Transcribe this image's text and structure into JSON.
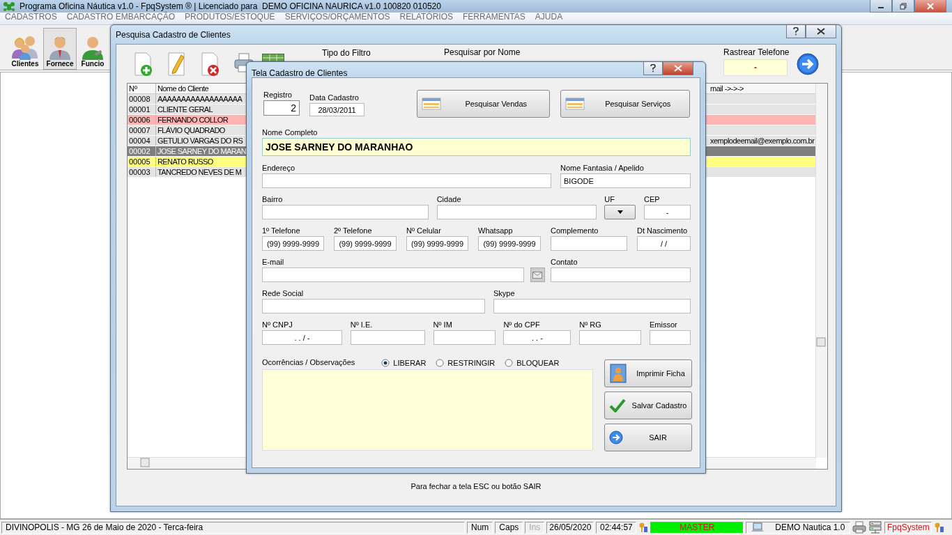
{
  "window": {
    "title": "Programa Oficina Náutica v1.0 - FpqSystem ® | Licenciado para  DEMO OFICINA NAURICA v1.0 100820 010520"
  },
  "menu": [
    "CADASTROS",
    "CADASTRO EMBARCAÇÃO",
    "PRODUTOS/ESTOQUE",
    "SERVIÇOS/ORÇAMENTOS",
    "RELATÓRIOS",
    "FERRAMENTAS",
    "AJUDA"
  ],
  "toolbar": [
    {
      "label": "Clientes",
      "selected": false
    },
    {
      "label": "Fornece",
      "selected": true
    },
    {
      "label": "Funcio",
      "selected": false
    }
  ],
  "search_window": {
    "title": "Pesquisa Cadastro de Clientes",
    "filter_label": "Tipo do Filtro",
    "name_label": "Pesquisar por Nome",
    "phone_label": "Rastrear Telefone",
    "phone_value": "-",
    "columns": [
      "Nº",
      "Nome do Cliente",
      "mail ->->->"
    ],
    "rows": [
      {
        "number": "00008",
        "name": "AAAAAAAAAAAAAAAAAA",
        "selected": false,
        "color": "#e4e4e4"
      },
      {
        "number": "00001",
        "name": "CLIENTE GERAL",
        "selected": false,
        "color": "#e4e4e4"
      },
      {
        "number": "00006",
        "name": "FERNANDO COLLOR",
        "selected": false,
        "color": "#ffb3b3"
      },
      {
        "number": "00007",
        "name": "FLÁVIO QUADRADO",
        "selected": false,
        "color": "#e4e4e4"
      },
      {
        "number": "00004",
        "name": "GETULIO VARGAS DO RS",
        "email": "xemplodeemail@exemplo.com.br",
        "selected": false,
        "color": "#e4e4e4"
      },
      {
        "number": "00002",
        "name": "JOSE SARNEY DO MARAN",
        "selected": true
      },
      {
        "number": "00005",
        "name": "RENATO RUSSO",
        "selected": false,
        "color": "#ffff80"
      },
      {
        "number": "00003",
        "name": "TANCREDO NEVES DE M",
        "selected": false,
        "color": "#e4e4e4"
      }
    ],
    "footer": "Para fechar a tela ESC ou botão SAIR"
  },
  "record_window": {
    "title": "Tela Cadastro de Clientes",
    "registro_label": "Registro",
    "registro": "2",
    "date_label": "Data Cadastro",
    "date": "28/03/2011",
    "top_buttons": [
      "Pesquisar Vendas",
      "Pesquisar Serviços"
    ],
    "name_label": "Nome Completo",
    "name": "JOSE SARNEY DO MARANHAO",
    "form_rows": [
      [
        {
          "kind": "text",
          "label": "Endereço"
        },
        {
          "kind": "text",
          "label": "Nome Fantasia / Apelido",
          "value": "BIGODE"
        }
      ],
      [
        {
          "kind": "text",
          "label": "Bairro"
        },
        {
          "kind": "text",
          "label": "Cidade"
        },
        {
          "kind": "dropdown",
          "label": "UF"
        },
        {
          "kind": "text",
          "label": "CEP",
          "value": "-"
        }
      ],
      [
        {
          "kind": "text",
          "label": "1º Telefone",
          "value": "(99) 9999-9999"
        },
        {
          "kind": "text",
          "label": "2º Telefone",
          "value": "(99) 9999-9999"
        },
        {
          "kind": "text",
          "label": "Nº Celular",
          "value": "(99) 9999-9999"
        },
        {
          "kind": "text",
          "label": "Whatsapp",
          "value": "(99) 9999-9999"
        },
        {
          "kind": "text",
          "label": "Complemento"
        },
        {
          "kind": "text",
          "label": "Dt Nascimento",
          "value": "/ /"
        }
      ],
      [
        {
          "kind": "text",
          "label": "E-mail"
        },
        {
          "kind": "button"
        },
        {
          "kind": "text",
          "label": "Contato"
        }
      ],
      [
        {
          "kind": "text",
          "label": "Rede Social"
        },
        {
          "kind": "text",
          "label": "Skype"
        }
      ],
      [
        {
          "kind": "text",
          "label": "Nº CNPJ",
          "value": ". . / -"
        },
        {
          "kind": "text",
          "label": "Nº I.E."
        },
        {
          "kind": "text",
          "label": "Nº IM"
        },
        {
          "kind": "text",
          "label": "Nº do CPF",
          "value": ". . -"
        },
        {
          "kind": "text",
          "label": "Nº RG"
        },
        {
          "kind": "text",
          "label": "Emissor"
        }
      ]
    ],
    "notes_label": "Ocorrências / Observações",
    "status_options": [
      {
        "label": "LIBERAR",
        "selected": true
      },
      {
        "label": "RESTRINGIR",
        "selected": false
      },
      {
        "label": "BLOQUEAR",
        "selected": false
      }
    ],
    "action_buttons": [
      {
        "kind": "print",
        "label": "Imprimir Ficha"
      },
      {
        "kind": "save",
        "label": "Salvar Cadastro"
      },
      {
        "kind": "exit",
        "label": "SAIR"
      }
    ]
  },
  "status_bar": [
    {
      "kind": "text",
      "text": "DIVINOPOLIS - MG 26 de Maio de 2020 - Terca-feira"
    },
    {
      "kind": "key",
      "text": "Num",
      "disabled": false
    },
    {
      "kind": "key",
      "text": "Caps",
      "disabled": false
    },
    {
      "kind": "key",
      "text": "Ins",
      "disabled": true
    },
    {
      "kind": "text",
      "text": "26/05/2020"
    },
    {
      "kind": "text",
      "text": "02:44:57"
    },
    {
      "kind": "user",
      "text": "MASTER"
    },
    {
      "kind": "station",
      "text": "DEMO Nautica 1.0"
    },
    {
      "kind": "printer"
    },
    {
      "kind": "network"
    },
    {
      "kind": "brand",
      "text": "FpqSystem"
    },
    {
      "kind": "keys"
    }
  ]
}
